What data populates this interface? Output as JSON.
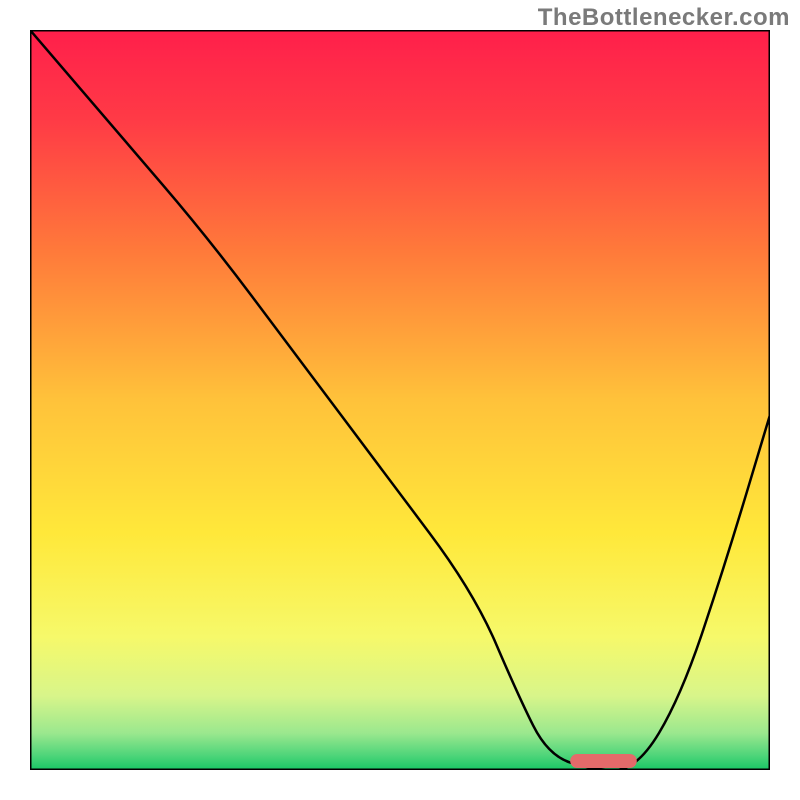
{
  "watermark": "TheBottlenecker.com",
  "chart_data": {
    "type": "line",
    "title": "",
    "xlabel": "",
    "ylabel": "",
    "xlim": [
      0,
      100
    ],
    "ylim": [
      0,
      100
    ],
    "grid": false,
    "background": "rainbow-gradient",
    "series": [
      {
        "name": "bottleneck-curve",
        "x": [
          0,
          12,
          24,
          36,
          48,
          60,
          66,
          70,
          76,
          82,
          88,
          94,
          100
        ],
        "values": [
          100,
          86,
          72,
          56,
          40,
          24,
          10,
          2,
          0,
          0,
          10,
          28,
          48
        ]
      }
    ],
    "marker": {
      "x_start": 73,
      "x_end": 82,
      "y": 0,
      "color": "#e46a6a"
    },
    "gradient_stops": [
      {
        "offset": 0,
        "color": "#ff1f4b"
      },
      {
        "offset": 0.12,
        "color": "#ff3a46"
      },
      {
        "offset": 0.3,
        "color": "#ff7a3a"
      },
      {
        "offset": 0.5,
        "color": "#ffc23a"
      },
      {
        "offset": 0.68,
        "color": "#ffe83a"
      },
      {
        "offset": 0.82,
        "color": "#f6f96a"
      },
      {
        "offset": 0.9,
        "color": "#d8f58a"
      },
      {
        "offset": 0.95,
        "color": "#9be88e"
      },
      {
        "offset": 0.98,
        "color": "#4fd57a"
      },
      {
        "offset": 1.0,
        "color": "#18c765"
      }
    ]
  }
}
